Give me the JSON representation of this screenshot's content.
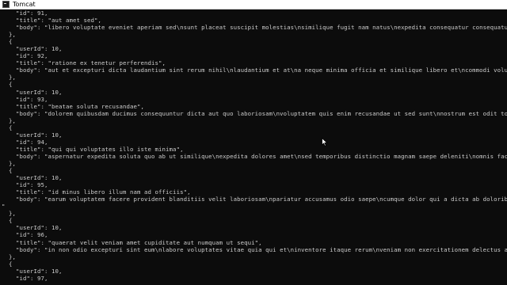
{
  "window": {
    "title": "Tomcat"
  },
  "console": {
    "lines": [
      "    \"id\": 91,",
      "    \"title\": \"aut amet sed\",",
      "    \"body\": \"libero voluptate eveniet aperiam sed\\nsunt placeat suscipit molestias\\nsimilique fugit nam natus\\nexpedita consequatur consequatur dolores qui",
      "  },",
      "  {",
      "    \"userId\": 10,",
      "    \"id\": 92,",
      "    \"title\": \"ratione ex tenetur perferendis\",",
      "    \"body\": \"aut et excepturi dicta laudantium sint rerum nihil\\nlaudantium et at\\na neque minima officia et similique libero et\\ncommodi voluptate qui\"",
      "  },",
      "  {",
      "    \"userId\": 10,",
      "    \"id\": 93,",
      "    \"title\": \"beatae soluta recusandae\",",
      "    \"body\": \"dolorem quibusdam ducimus consequuntur dicta aut quo laboriosam\\nvoluptatem quis enim recusandae ut sed sunt\\nnostrum est odit totam\\nsit error",
      "  },",
      "  {",
      "    \"userId\": 10,",
      "    \"id\": 94,",
      "    \"title\": \"qui qui voluptates illo iste minima\",",
      "    \"body\": \"aspernatur expedita soluta quo ab ut similique\\nexpedita dolores amet\\nsed temporibus distinctio magnam saepe deleniti\\nomnis facilis nam ipsum",
      "  },",
      "  {",
      "    \"userId\": 10,",
      "    \"id\": 95,",
      "    \"title\": \"id minus libero illum nam ad officiis\",",
      "    \"body\": \"earum voluptatem facere provident blanditiis velit laboriosam\\npariatur accusamus odio saepe\\ncumque dolor qui a dicta ab doloribus consequatur",
      "\"",
      "  },",
      "  {",
      "    \"userId\": 10,",
      "    \"id\": 96,",
      "    \"title\": \"quaerat velit veniam amet cupiditate aut numquam ut sequi\",",
      "    \"body\": \"in non odio excepturi sint eum\\nlabore voluptates vitae quia qui et\\ninventore itaque rerum\\nveniam non exercitationem delectus aut\"",
      "  },",
      "  {",
      "    \"userId\": 10,",
      "    \"id\": 97,"
    ]
  },
  "cursor": {
    "icon": "arrow-pointer-icon"
  }
}
